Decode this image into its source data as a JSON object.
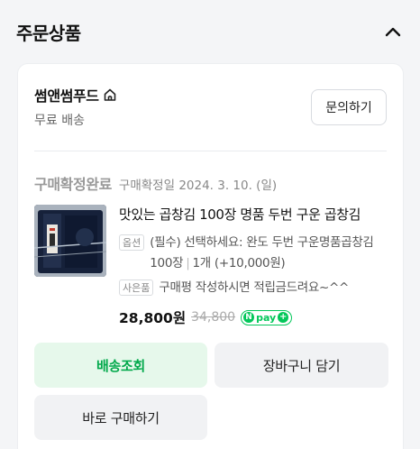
{
  "section": {
    "title": "주문상품"
  },
  "store": {
    "name": "썸앤썸푸드",
    "shipping": "무료 배송",
    "inquiry_label": "문의하기"
  },
  "order": {
    "status": "구매확정완료",
    "confirm_date": "구매확정일 2024. 3. 10. (일)"
  },
  "product": {
    "title": "맛있는 곱창김 100장 명품 두번 구운 곱창김",
    "option_tag": "옵션",
    "option_text": "(필수) 선택하세요: 완도 두번 구운명품곱창김 100장",
    "option_qty": "1개 (+10,000원)",
    "gift_tag": "사은품",
    "gift_text": "구매평 작성하시면 적립금드려요~^^",
    "price": "28,800원",
    "original_price": "34,800",
    "npay_label": "pay",
    "npay_n": "N",
    "npay_plus": "+"
  },
  "actions": {
    "track": "배송조회",
    "cart": "장바구니 담기",
    "buy_now": "바로 구매하기"
  },
  "colors": {
    "accent_green": "#03c75a",
    "track_bg": "#e6f8eb"
  },
  "icons": {
    "collapse": "chevron-up-icon",
    "store_home": "home-icon"
  }
}
